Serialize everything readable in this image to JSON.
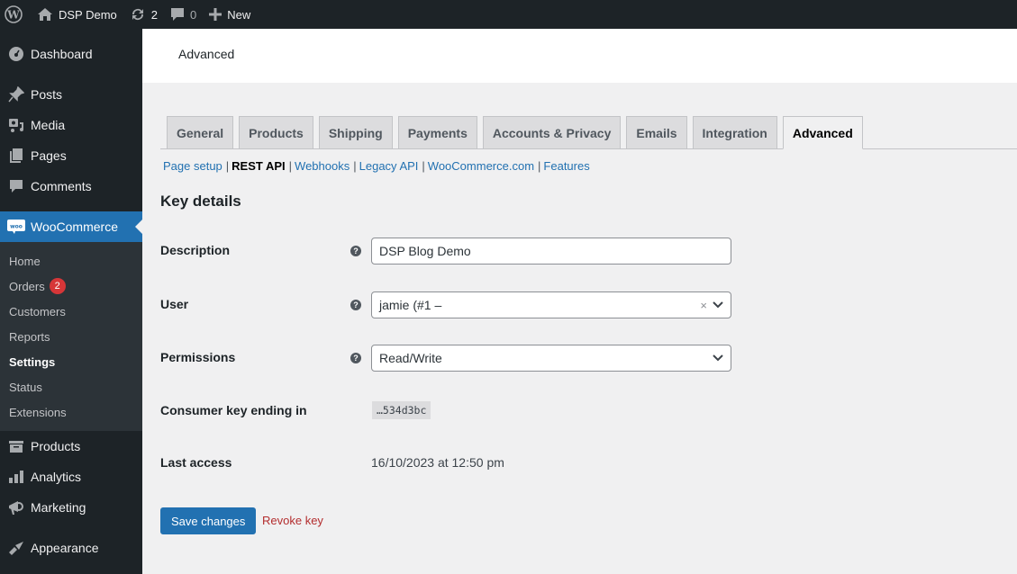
{
  "adminbar": {
    "site_name": "DSP Demo",
    "updates_count": "2",
    "comments_count": "0",
    "new_label": "New"
  },
  "sidebar": {
    "items": [
      {
        "label": "Dashboard",
        "icon": "dashboard-icon"
      },
      {
        "label": "Posts",
        "icon": "pin-icon"
      },
      {
        "label": "Media",
        "icon": "media-icon"
      },
      {
        "label": "Pages",
        "icon": "pages-icon"
      },
      {
        "label": "Comments",
        "icon": "comment-icon"
      },
      {
        "label": "WooCommerce",
        "icon": "woo-icon",
        "active": true
      },
      {
        "label": "Products",
        "icon": "archive-icon"
      },
      {
        "label": "Analytics",
        "icon": "bar-chart-icon"
      },
      {
        "label": "Marketing",
        "icon": "megaphone-icon"
      },
      {
        "label": "Appearance",
        "icon": "paintbrush-icon"
      }
    ],
    "woo_submenu": [
      {
        "label": "Home"
      },
      {
        "label": "Orders",
        "badge": "2"
      },
      {
        "label": "Customers"
      },
      {
        "label": "Reports"
      },
      {
        "label": "Settings",
        "current": true
      },
      {
        "label": "Status"
      },
      {
        "label": "Extensions"
      }
    ]
  },
  "header": {
    "title": "Advanced"
  },
  "tabs": [
    {
      "label": "General"
    },
    {
      "label": "Products"
    },
    {
      "label": "Shipping"
    },
    {
      "label": "Payments"
    },
    {
      "label": "Accounts & Privacy"
    },
    {
      "label": "Emails"
    },
    {
      "label": "Integration"
    },
    {
      "label": "Advanced",
      "active": true
    }
  ],
  "subnav": [
    {
      "label": "Page setup"
    },
    {
      "label": "REST API",
      "current": true
    },
    {
      "label": "Webhooks"
    },
    {
      "label": "Legacy API"
    },
    {
      "label": "WooCommerce.com"
    },
    {
      "label": "Features"
    }
  ],
  "subnav_separator": "|",
  "form": {
    "section_title": "Key details",
    "help_glyph": "?",
    "description": {
      "label": "Description",
      "value": "DSP Blog Demo"
    },
    "user": {
      "label": "User",
      "value": "jamie (#1 –",
      "clear_glyph": "×"
    },
    "permissions": {
      "label": "Permissions",
      "value": "Read/Write"
    },
    "consumer_key": {
      "label": "Consumer key ending in",
      "value": "…534d3bc"
    },
    "last_access": {
      "label": "Last access",
      "value": "16/10/2023 at 12:50 pm"
    },
    "save_label": "Save changes",
    "revoke_label": "Revoke key"
  }
}
